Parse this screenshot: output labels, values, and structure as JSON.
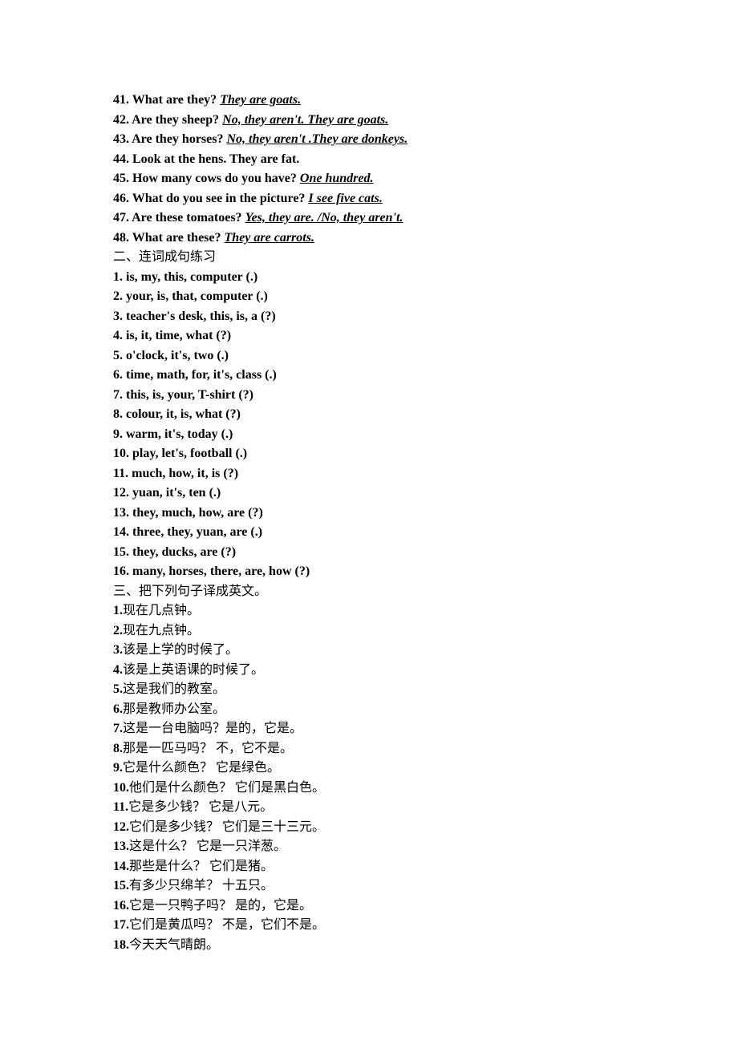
{
  "lines": [
    {
      "parts": [
        {
          "text": "41. What are they?",
          "bold": true
        },
        {
          "text": "        "
        },
        {
          "text": "They are goats.   ",
          "bold": true,
          "ital": true,
          "underline": true
        }
      ]
    },
    {
      "parts": [
        {
          "text": "42. Are they sheep?",
          "bold": true
        },
        {
          "text": "      "
        },
        {
          "text": "No, they aren't. They are goats. ",
          "bold": true,
          "ital": true,
          "underline": true
        }
      ]
    },
    {
      "parts": [
        {
          "text": "43. Are they horses?",
          "bold": true
        },
        {
          "text": "    "
        },
        {
          "text": "No, they aren't .They are donkeys. ",
          "bold": true,
          "ital": true,
          "underline": true
        }
      ]
    },
    {
      "parts": [
        {
          "text": "44. Look at the hens.      They are fat.",
          "bold": true
        }
      ]
    },
    {
      "parts": [
        {
          "text": "45. How many cows do you have?",
          "bold": true
        },
        {
          "text": "   "
        },
        {
          "text": "One hundred.",
          "bold": true,
          "ital": true,
          "underline": true
        }
      ]
    },
    {
      "parts": [
        {
          "text": "46. What do you see in the picture?",
          "bold": true
        },
        {
          "text": "    "
        },
        {
          "text": "I see five cats. ",
          "bold": true,
          "ital": true,
          "underline": true
        }
      ]
    },
    {
      "parts": [
        {
          "text": "47. Are these tomatoes?",
          "bold": true
        },
        {
          "text": "        "
        },
        {
          "text": "Yes, they are. /No, they aren't. ",
          "bold": true,
          "ital": true,
          "underline": true
        }
      ]
    },
    {
      "parts": [
        {
          "text": "48. What are these? ",
          "bold": true
        },
        {
          "text": "They are carrots.",
          "bold": true,
          "ital": true,
          "underline": true
        }
      ]
    },
    {
      "parts": [
        {
          "text": "二、连词成句练习",
          "cn": true
        }
      ]
    },
    {
      "parts": [
        {
          "text": "1. is, my, this, computer (.)",
          "bold": true
        }
      ]
    },
    {
      "parts": [
        {
          "text": "2. your, is, that, computer (.)",
          "bold": true
        }
      ]
    },
    {
      "parts": [
        {
          "text": "3. teacher's desk, this, is, a (?)",
          "bold": true
        }
      ]
    },
    {
      "parts": [
        {
          "text": "4. is, it, time, what (?)",
          "bold": true
        }
      ]
    },
    {
      "parts": [
        {
          "text": "5. o'clock, it's, two (.)",
          "bold": true
        }
      ]
    },
    {
      "parts": [
        {
          "text": "6. time, math, for, it's, class (.)",
          "bold": true
        }
      ]
    },
    {
      "parts": [
        {
          "text": "7. this, is, your, T-shirt (?)",
          "bold": true
        }
      ]
    },
    {
      "parts": [
        {
          "text": "8. colour, it, is, what (?)",
          "bold": true
        }
      ]
    },
    {
      "parts": [
        {
          "text": "9. warm, it's, today (.)",
          "bold": true
        }
      ]
    },
    {
      "parts": [
        {
          "text": "10. play, let's, football (.)",
          "bold": true
        }
      ]
    },
    {
      "parts": [
        {
          "text": "11. much, how, it, is (?)",
          "bold": true
        }
      ]
    },
    {
      "parts": [
        {
          "text": "12. yuan, it's, ten (.)",
          "bold": true
        }
      ]
    },
    {
      "parts": [
        {
          "text": "13. they, much, how, are (?)",
          "bold": true
        }
      ]
    },
    {
      "parts": [
        {
          "text": "14. three, they, yuan, are (.)",
          "bold": true
        }
      ]
    },
    {
      "parts": [
        {
          "text": "15. they, ducks, are (?)",
          "bold": true
        }
      ]
    },
    {
      "parts": [
        {
          "text": "16. many, horses, there, are, how (?)",
          "bold": true
        }
      ]
    },
    {
      "parts": [
        {
          "text": "三、把下列句子译成英文。",
          "cn": true
        }
      ]
    },
    {
      "parts": [
        {
          "text": "1.",
          "bold": true
        },
        {
          "text": "现在几点钟。",
          "cn": true
        }
      ]
    },
    {
      "parts": [
        {
          "text": "2.",
          "bold": true
        },
        {
          "text": "现在九点钟。",
          "cn": true
        }
      ]
    },
    {
      "parts": [
        {
          "text": "3.",
          "bold": true
        },
        {
          "text": "该是上学的时候了。",
          "cn": true
        }
      ]
    },
    {
      "parts": [
        {
          "text": "4.",
          "bold": true
        },
        {
          "text": "该是上英语课的时候了。",
          "cn": true
        }
      ]
    },
    {
      "parts": [
        {
          "text": "5.",
          "bold": true
        },
        {
          "text": "这是我们的教室。",
          "cn": true
        }
      ]
    },
    {
      "parts": [
        {
          "text": "6.",
          "bold": true
        },
        {
          "text": "那是教师办公室。",
          "cn": true
        }
      ]
    },
    {
      "parts": [
        {
          "text": "7.",
          "bold": true
        },
        {
          "text": "这是一台电脑吗？是的，它是。",
          "cn": true
        }
      ]
    },
    {
      "parts": [
        {
          "text": "8.",
          "bold": true
        },
        {
          "text": "那是一匹马吗？  不，它不是。",
          "cn": true
        }
      ]
    },
    {
      "parts": [
        {
          "text": "9.",
          "bold": true
        },
        {
          "text": "它是什么颜色？  它是绿色。",
          "cn": true
        }
      ]
    },
    {
      "parts": [
        {
          "text": "10.",
          "bold": true
        },
        {
          "text": "他们是什么颜色？  它们是黑白色。",
          "cn": true
        }
      ]
    },
    {
      "parts": [
        {
          "text": "11.",
          "bold": true
        },
        {
          "text": "它是多少钱？  它是八元。",
          "cn": true
        }
      ]
    },
    {
      "parts": [
        {
          "text": "12.",
          "bold": true
        },
        {
          "text": "它们是多少钱？  它们是三十三元。",
          "cn": true
        }
      ]
    },
    {
      "parts": [
        {
          "text": "13.",
          "bold": true
        },
        {
          "text": "这是什么？  它是一只洋葱。",
          "cn": true
        }
      ]
    },
    {
      "parts": [
        {
          "text": "14.",
          "bold": true
        },
        {
          "text": "那些是什么？  它们是猪。",
          "cn": true
        }
      ]
    },
    {
      "parts": [
        {
          "text": "15.",
          "bold": true
        },
        {
          "text": "有多少只绵羊？  十五只。",
          "cn": true
        }
      ]
    },
    {
      "parts": [
        {
          "text": "16.",
          "bold": true
        },
        {
          "text": "它是一只鸭子吗？  是的，它是。",
          "cn": true
        }
      ]
    },
    {
      "parts": [
        {
          "text": "17.",
          "bold": true
        },
        {
          "text": "它们是黄瓜吗？  不是，它们不是。",
          "cn": true
        }
      ]
    },
    {
      "parts": [
        {
          "text": "18.",
          "bold": true
        },
        {
          "text": "今天天气晴朗。",
          "cn": true
        }
      ]
    }
  ]
}
